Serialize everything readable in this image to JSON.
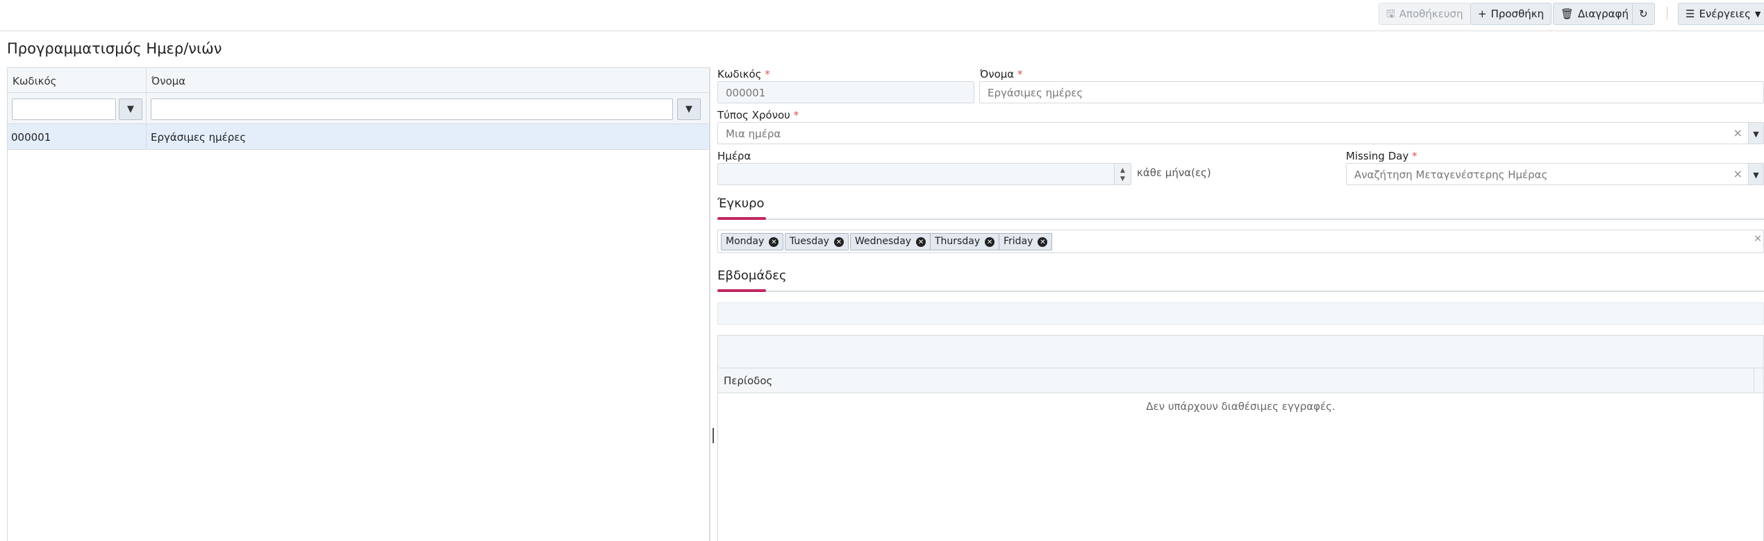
{
  "toolbar": {
    "save_label": "Αποθήκευση",
    "add_label": "Προσθήκη",
    "delete_label": "Διαγραφή",
    "actions_label": "Ενέργειες"
  },
  "page": {
    "title": "Προγραμματισμός Ημερ/νιών"
  },
  "list": {
    "columns": [
      "Κωδικός",
      "Όνομα"
    ],
    "rows": [
      {
        "code": "000001",
        "name": "Εργάσιμες ημέρες"
      }
    ]
  },
  "form": {
    "code_label": "Κωδικός",
    "code_value": "000001",
    "name_label": "Όνομα",
    "name_value": "Εργάσιμες ημέρες",
    "time_type_label": "Τύπος Χρόνου",
    "time_type_value": "Μια ημέρα",
    "day_label": "Ημέρα",
    "day_value": "",
    "day_suffix": "κάθε μήνα(ες)",
    "missing_day_label": "Missing Day",
    "missing_day_value": "Αναζήτηση Μεταγενέστερης Ημέρας",
    "required_marker": "*"
  },
  "valid": {
    "title": "Έγκυρο",
    "days": [
      "Monday",
      "Tuesday",
      "Wednesday",
      "Thursday",
      "Friday"
    ]
  },
  "weeks": {
    "title": "Εβδομάδες",
    "column": "Περίοδος",
    "empty_message": "Δεν υπάρχουν διαθέσιμες εγγραφές."
  },
  "colors": {
    "accent": "#c0265f",
    "selected_row": "#e4eefb",
    "required": "#d9534f"
  }
}
